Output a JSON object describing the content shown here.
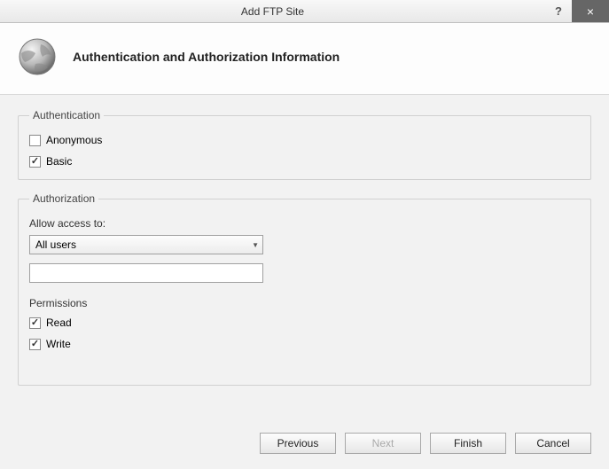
{
  "window": {
    "title": "Add FTP Site",
    "help_symbol": "?",
    "close_symbol": "×"
  },
  "header": {
    "title": "Authentication and Authorization Information"
  },
  "authentication": {
    "legend": "Authentication",
    "anonymous_label": "Anonymous",
    "anonymous_checked": false,
    "basic_label": "Basic",
    "basic_checked": true
  },
  "authorization": {
    "legend": "Authorization",
    "allow_access_label": "Allow access to:",
    "selected_option": "All users",
    "text_value": "",
    "permissions_label": "Permissions",
    "read_label": "Read",
    "read_checked": true,
    "write_label": "Write",
    "write_checked": true
  },
  "buttons": {
    "previous": "Previous",
    "next": "Next",
    "finish": "Finish",
    "cancel": "Cancel"
  }
}
